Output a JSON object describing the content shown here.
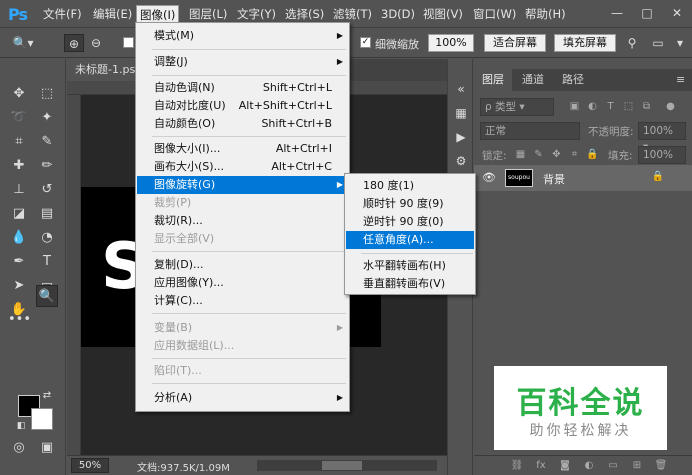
{
  "app": {
    "logo": "Ps"
  },
  "menubar": {
    "items": [
      "文件(F)",
      "编辑(E)",
      "图像(I)",
      "图层(L)",
      "文字(Y)",
      "选择(S)",
      "滤镜(T)",
      "3D(D)",
      "视图(V)",
      "窗口(W)",
      "帮助(H)"
    ],
    "active_index": 2
  },
  "window_controls": {
    "minimize": "—",
    "restore": "□",
    "close": "✕"
  },
  "options_bar": {
    "scrubby_zoom_label": "细微缩放",
    "zoom_value": "100%",
    "fit_screen_label": "适合屏幕",
    "fill_screen_label": "填充屏幕"
  },
  "document": {
    "tab_title": "未标题-1.psd",
    "canvas_text": "S",
    "zoom": "50%",
    "info": "文档:937.5K/1.09M"
  },
  "image_menu": {
    "items": [
      {
        "label": "模式(M)",
        "shortcut": "",
        "submenu": true,
        "disabled": false
      },
      {
        "label": "调整(J)",
        "shortcut": "",
        "submenu": true,
        "disabled": false
      },
      {
        "label": "自动色调(N)",
        "shortcut": "Shift+Ctrl+L",
        "submenu": false,
        "disabled": false
      },
      {
        "label": "自动对比度(U)",
        "shortcut": "Alt+Shift+Ctrl+L",
        "submenu": false,
        "disabled": false
      },
      {
        "label": "自动颜色(O)",
        "shortcut": "Shift+Ctrl+B",
        "submenu": false,
        "disabled": false
      },
      {
        "label": "图像大小(I)...",
        "shortcut": "Alt+Ctrl+I",
        "submenu": false,
        "disabled": false
      },
      {
        "label": "画布大小(S)...",
        "shortcut": "Alt+Ctrl+C",
        "submenu": false,
        "disabled": false
      },
      {
        "label": "图像旋转(G)",
        "shortcut": "",
        "submenu": true,
        "disabled": false,
        "highlighted": true
      },
      {
        "label": "裁剪(P)",
        "shortcut": "",
        "submenu": false,
        "disabled": true
      },
      {
        "label": "裁切(R)...",
        "shortcut": "",
        "submenu": false,
        "disabled": false
      },
      {
        "label": "显示全部(V)",
        "shortcut": "",
        "submenu": false,
        "disabled": true
      },
      {
        "label": "复制(D)...",
        "shortcut": "",
        "submenu": false,
        "disabled": false
      },
      {
        "label": "应用图像(Y)...",
        "shortcut": "",
        "submenu": false,
        "disabled": false
      },
      {
        "label": "计算(C)...",
        "shortcut": "",
        "submenu": false,
        "disabled": false
      },
      {
        "label": "变量(B)",
        "shortcut": "",
        "submenu": true,
        "disabled": true
      },
      {
        "label": "应用数据组(L)...",
        "shortcut": "",
        "submenu": false,
        "disabled": true
      },
      {
        "label": "陷印(T)...",
        "shortcut": "",
        "submenu": false,
        "disabled": true
      },
      {
        "label": "分析(A)",
        "shortcut": "",
        "submenu": true,
        "disabled": false
      }
    ]
  },
  "rotate_submenu": {
    "items": [
      {
        "label": "180 度(1)",
        "highlighted": false
      },
      {
        "label": "顺时针 90 度(9)",
        "highlighted": false
      },
      {
        "label": "逆时针 90 度(0)",
        "highlighted": false
      },
      {
        "label": "任意角度(A)...",
        "highlighted": true
      },
      {
        "label": "水平翻转画布(H)",
        "highlighted": false
      },
      {
        "label": "垂直翻转画布(V)",
        "highlighted": false
      }
    ]
  },
  "layers_panel": {
    "tabs": [
      "图层",
      "通道",
      "路径"
    ],
    "active_tab": 0,
    "filter_kind": "类型",
    "blend_mode": "正常",
    "opacity_label": "不透明度:",
    "opacity_value": "100%",
    "lock_label": "锁定:",
    "fill_label": "填充:",
    "fill_value": "100%",
    "layer": {
      "name": "背景",
      "thumb_text": "soupou"
    }
  },
  "watermark": {
    "title": "百科全说",
    "subtitle": "助你轻松解决"
  },
  "colors": {
    "accent": "#0078d7",
    "ps_blue": "#31a8ff",
    "watermark_green": "#2cb04a"
  }
}
